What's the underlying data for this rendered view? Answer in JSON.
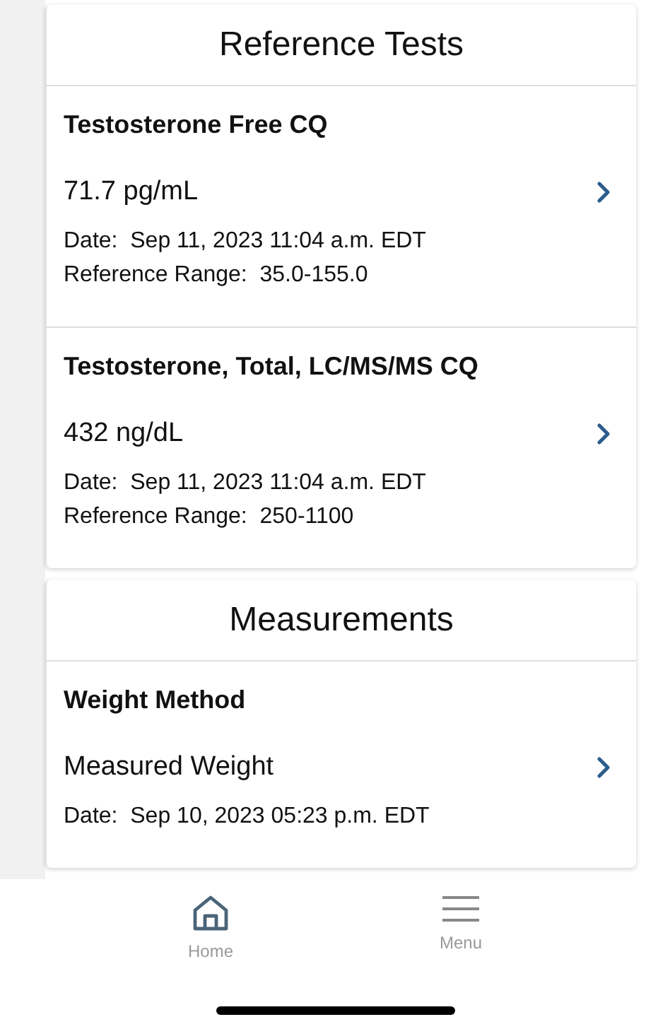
{
  "sections": [
    {
      "title": "Reference Tests",
      "items": [
        {
          "name": "Testosterone Free CQ",
          "value": "71.7 pg/mL",
          "details": [
            "Date:  Sep 11, 2023 11:04 a.m. EDT",
            "Reference Range:  35.0-155.0"
          ]
        },
        {
          "name": "Testosterone, Total, LC/MS/MS CQ",
          "value": "432 ng/dL",
          "details": [
            "Date:  Sep 11, 2023 11:04 a.m. EDT",
            "Reference Range:  250-1100"
          ]
        }
      ]
    },
    {
      "title": "Measurements",
      "items": [
        {
          "name": "Weight Method",
          "value": "Measured Weight",
          "details": [
            "Date:  Sep 10, 2023 05:23 p.m. EDT"
          ]
        }
      ]
    }
  ],
  "tab_bar": [
    {
      "kind": "home",
      "label": "Home",
      "selected": true
    },
    {
      "kind": "menu",
      "label": "Menu",
      "selected": false
    }
  ]
}
